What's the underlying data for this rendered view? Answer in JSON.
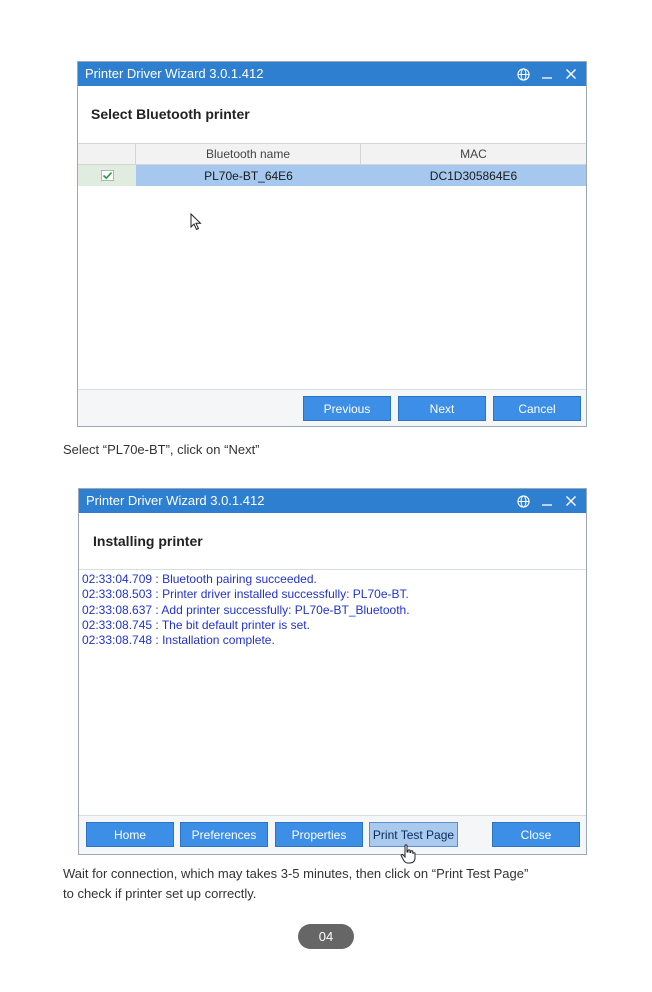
{
  "window1": {
    "title": "Printer Driver Wizard  3.0.1.412",
    "heading": "Select Bluetooth printer",
    "columns": [
      "Bluetooth name",
      "MAC"
    ],
    "rows": [
      {
        "name": "PL70e-BT_64E6",
        "mac": "DC1D305864E6",
        "checked": true
      }
    ],
    "buttons": {
      "previous": "Previous",
      "next": "Next",
      "cancel": "Cancel"
    }
  },
  "caption1": "Select “PL70e-BT”, click on “Next”",
  "window2": {
    "title": "Printer Driver Wizard  3.0.1.412",
    "heading": "Installing printer",
    "log": [
      "02:33:04.709 : Bluetooth pairing succeeded.",
      "02:33:08.503 : Printer driver installed successfully: PL70e-BT.",
      "02:33:08.637 : Add printer successfully: PL70e-BT_Bluetooth.",
      "02:33:08.745 : The bit default printer is set.",
      "02:33:08.748 : Installation complete."
    ],
    "buttons": {
      "home": "Home",
      "preferences": "Preferences",
      "properties": "Properties",
      "print_test": "Print Test Page",
      "close": "Close"
    }
  },
  "caption2": {
    "line1": "Wait for connection, which may takes 3-5 minutes, then click on “Print Test Page”",
    "line2": "to check if printer set up correctly."
  },
  "page_number": "04",
  "colors": {
    "titlebar": "#2f7fd0",
    "button": "#3c8ee6",
    "selected_row": "#a6c8ee",
    "log_text": "#2233cc"
  }
}
